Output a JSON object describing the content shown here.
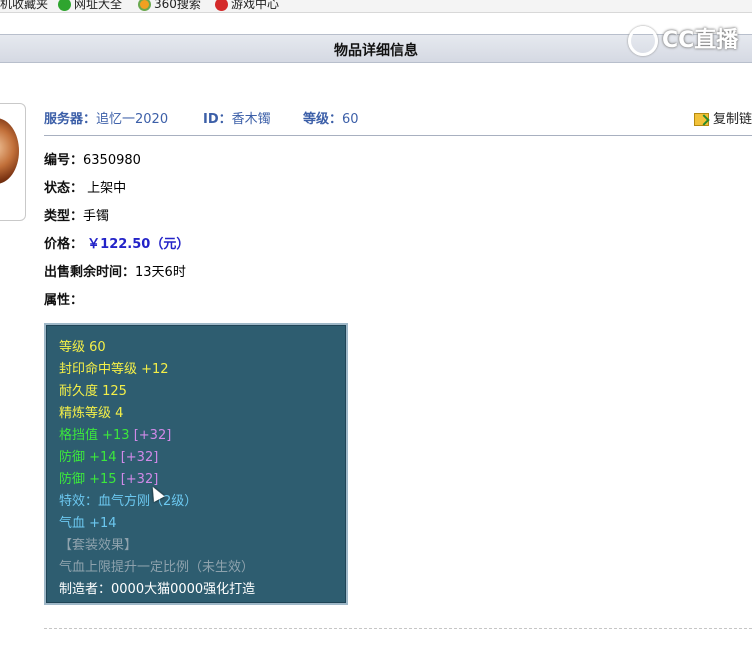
{
  "favorites_bar": {
    "items": [
      {
        "label": "机收藏夹",
        "icon": "star-icon"
      },
      {
        "label": "网址大全",
        "icon": "plus-icon"
      },
      {
        "label": "360搜索",
        "icon": "search-360-icon"
      },
      {
        "label": "游戏中心",
        "icon": "game-center-icon"
      }
    ]
  },
  "page": {
    "title": "物品详细信息",
    "watermark": "CC直播"
  },
  "info": {
    "server_label": "服务器：",
    "server_value": "追忆一2020",
    "id_label": "ID：",
    "id_value": "香木镯",
    "level_label": "等级：",
    "level_value": "60",
    "copy_link_label": "复制链接"
  },
  "details": {
    "number_label": "编号：",
    "number_value": "6350980",
    "status_label": "状态：",
    "status_value": "上架中",
    "type_label": "类型：",
    "type_value": "手镯",
    "price_label": "价格：",
    "price_value": "￥122.50（元）",
    "remaining_label": "出售剩余时间：",
    "remaining_value": "13天6时",
    "attributes_label": "属性："
  },
  "attributes": [
    {
      "text": "等级 60",
      "color": "#f4ef48"
    },
    {
      "text": "封印命中等级 +12",
      "color": "#f4ef48"
    },
    {
      "text": "耐久度 125",
      "color": "#f4ef48"
    },
    {
      "text": "精炼等级 4",
      "color": "#f4ef48"
    },
    {
      "text": "格挡值 +13",
      "extra": "[+32]",
      "color": "#3ce83c"
    },
    {
      "text": "防御 +14",
      "extra": "[+32]",
      "color": "#3ce83c"
    },
    {
      "text": "防御 +15",
      "extra": "[+32]",
      "color": "#3ce83c"
    },
    {
      "text": "特效：血气方刚（2级）",
      "color": "#6cc8f0"
    },
    {
      "text": "气血 +14",
      "color": "#6cc8f0"
    },
    {
      "text": "【套装效果】",
      "color": "#8ea2ad"
    },
    {
      "text": "气血上限提升一定比例（未生效）",
      "color": "#8ea2ad"
    },
    {
      "text": "制造者：0000大猫0000强化打造",
      "color": "#ffffff"
    }
  ]
}
